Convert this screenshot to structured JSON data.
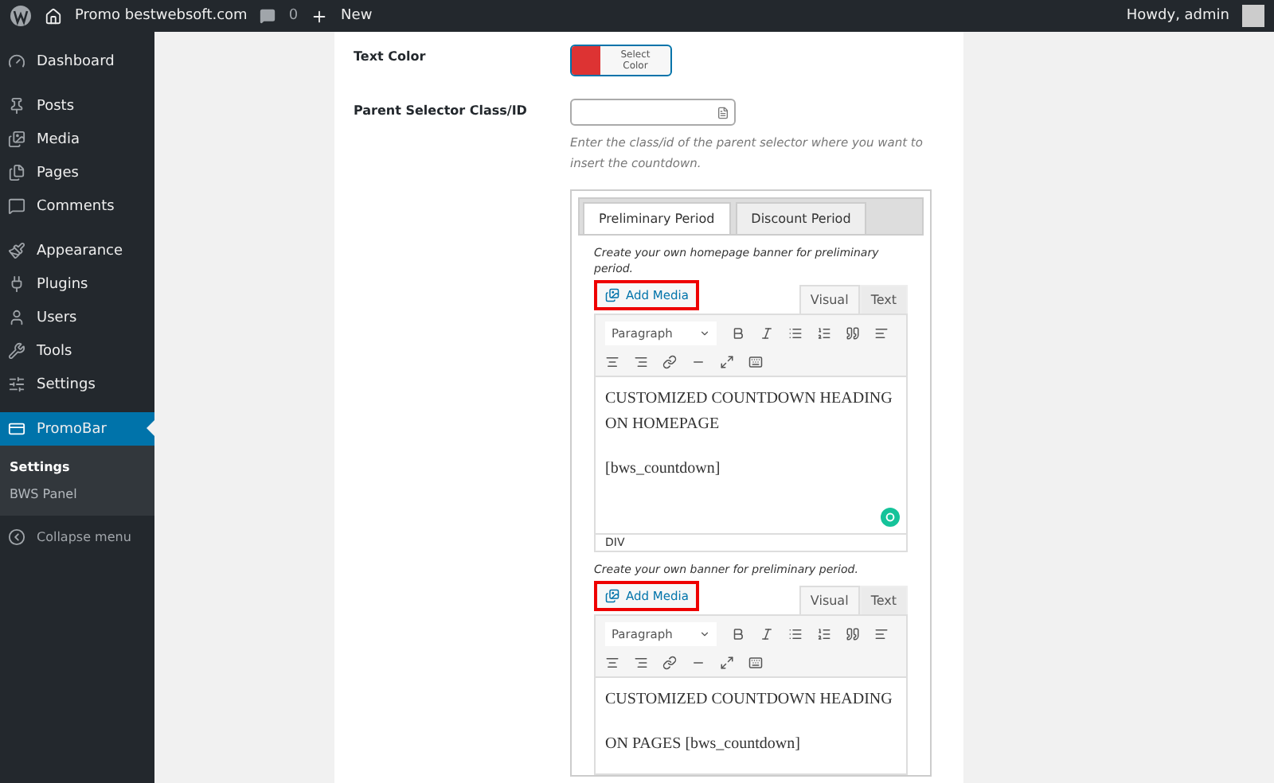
{
  "admin_bar": {
    "site": "Promo bestwebsoft.com",
    "comments": "0",
    "new": "New",
    "greeting": "Howdy, admin"
  },
  "sidebar": {
    "items": [
      {
        "label": "Dashboard",
        "selected": false
      },
      {
        "label": "Posts",
        "selected": false
      },
      {
        "label": "Media",
        "selected": false
      },
      {
        "label": "Pages",
        "selected": false
      },
      {
        "label": "Comments",
        "selected": false
      },
      {
        "label": "Appearance",
        "selected": false
      },
      {
        "label": "Plugins",
        "selected": false
      },
      {
        "label": "Users",
        "selected": false
      },
      {
        "label": "Tools",
        "selected": false
      },
      {
        "label": "Settings",
        "selected": false
      },
      {
        "label": "PromoBar",
        "selected": true
      }
    ],
    "submenu": [
      {
        "label": "Settings",
        "selected": true
      },
      {
        "label": "BWS Panel",
        "selected": false
      }
    ],
    "collapse": "Collapse menu"
  },
  "form": {
    "text_color": {
      "label": "Text Color",
      "color": "#dd3333",
      "button": "Select Color"
    },
    "parent_selector": {
      "label": "Parent Selector Class/ID",
      "description": "Enter the class/id of the parent selector where you want to insert the countdown."
    },
    "period_tabs": [
      {
        "label": "Preliminary Period",
        "selected": true
      },
      {
        "label": "Discount Period",
        "selected": false
      }
    ],
    "editors": [
      {
        "help": "Create your own homepage banner for preliminary period.",
        "add_media": "Add Media",
        "modes": [
          {
            "label": "Visual",
            "selected": true
          },
          {
            "label": "Text",
            "selected": false
          }
        ],
        "format": "Paragraph",
        "content": [
          "CUSTOMIZED COUNTDOWN HEADING ON HOMEPAGE",
          "[bws_countdown]"
        ],
        "status": "DIV"
      },
      {
        "help": "Create your own banner for preliminary period.",
        "add_media": "Add Media",
        "modes": [
          {
            "label": "Visual",
            "selected": true
          },
          {
            "label": "Text",
            "selected": false
          }
        ],
        "format": "Paragraph",
        "content": [
          "CUSTOMIZED COUNTDOWN HEADING",
          "ON PAGES [bws_countdown]"
        ]
      }
    ]
  }
}
